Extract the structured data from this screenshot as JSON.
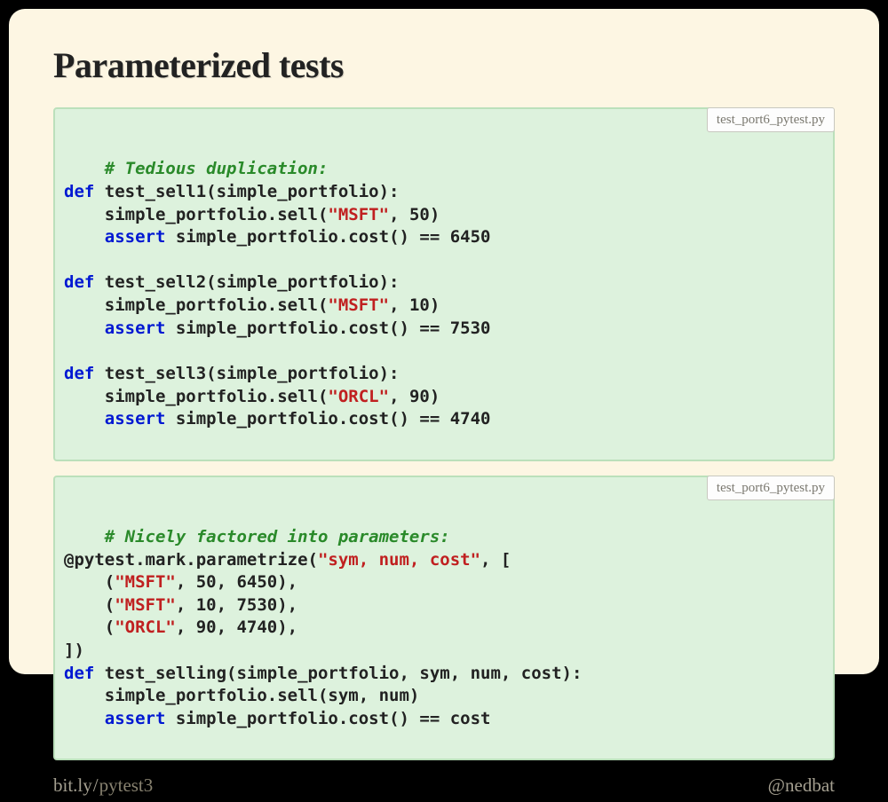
{
  "title": "Parameterized tests",
  "block1": {
    "filename": "test_port6_pytest.py",
    "tokens": [
      {
        "t": "# Tedious duplication:\n",
        "cls": "c-comment"
      },
      {
        "t": "def",
        "cls": "c-kw"
      },
      {
        "t": " test_sell1(simple_portfolio):\n"
      },
      {
        "t": "    simple_portfolio.sell("
      },
      {
        "t": "\"MSFT\"",
        "cls": "c-str"
      },
      {
        "t": ", 50)\n"
      },
      {
        "t": "    "
      },
      {
        "t": "assert",
        "cls": "c-kw"
      },
      {
        "t": " simple_portfolio.cost() == 6450\n"
      },
      {
        "t": "\n"
      },
      {
        "t": "def",
        "cls": "c-kw"
      },
      {
        "t": " test_sell2(simple_portfolio):\n"
      },
      {
        "t": "    simple_portfolio.sell("
      },
      {
        "t": "\"MSFT\"",
        "cls": "c-str"
      },
      {
        "t": ", 10)\n"
      },
      {
        "t": "    "
      },
      {
        "t": "assert",
        "cls": "c-kw"
      },
      {
        "t": " simple_portfolio.cost() == 7530\n"
      },
      {
        "t": "\n"
      },
      {
        "t": "def",
        "cls": "c-kw"
      },
      {
        "t": " test_sell3(simple_portfolio):\n"
      },
      {
        "t": "    simple_portfolio.sell("
      },
      {
        "t": "\"ORCL\"",
        "cls": "c-str"
      },
      {
        "t": ", 90)\n"
      },
      {
        "t": "    "
      },
      {
        "t": "assert",
        "cls": "c-kw"
      },
      {
        "t": " simple_portfolio.cost() == 4740"
      }
    ]
  },
  "block2": {
    "filename": "test_port6_pytest.py",
    "tokens": [
      {
        "t": "# Nicely factored into parameters:\n",
        "cls": "c-comment"
      },
      {
        "t": "@pytest.mark.parametrize("
      },
      {
        "t": "\"sym, num, cost\"",
        "cls": "c-str"
      },
      {
        "t": ", [\n"
      },
      {
        "t": "    ("
      },
      {
        "t": "\"MSFT\"",
        "cls": "c-str"
      },
      {
        "t": ", 50, 6450),\n"
      },
      {
        "t": "    ("
      },
      {
        "t": "\"MSFT\"",
        "cls": "c-str"
      },
      {
        "t": ", 10, 7530),\n"
      },
      {
        "t": "    ("
      },
      {
        "t": "\"ORCL\"",
        "cls": "c-str"
      },
      {
        "t": ", 90, 4740),\n"
      },
      {
        "t": "])\n"
      },
      {
        "t": "def",
        "cls": "c-kw"
      },
      {
        "t": " test_selling(simple_portfolio, sym, num, cost):\n"
      },
      {
        "t": "    simple_portfolio.sell(sym, num)\n"
      },
      {
        "t": "    "
      },
      {
        "t": "assert",
        "cls": "c-kw"
      },
      {
        "t": " simple_portfolio.cost() == cost"
      }
    ]
  },
  "footer": {
    "link_prefix": "bit.ly",
    "link_sep": "/",
    "link_tail": "pytest3",
    "handle": "@nedbat"
  }
}
